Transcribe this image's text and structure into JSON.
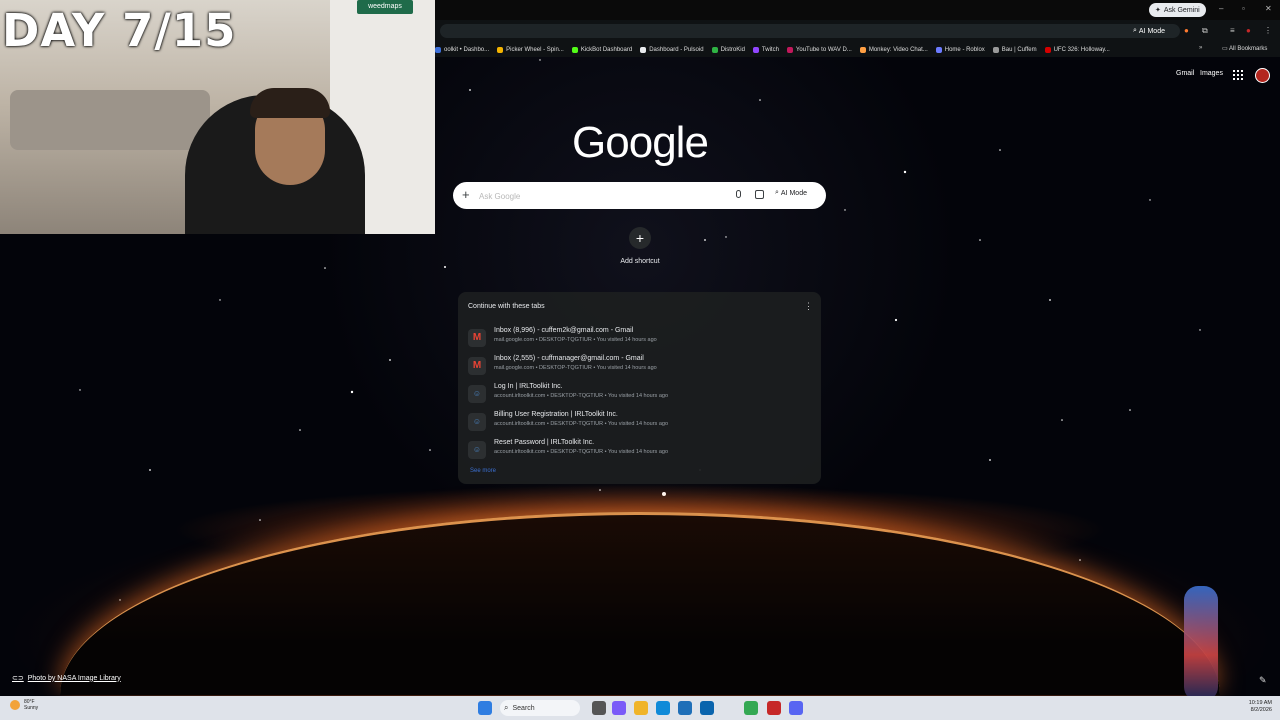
{
  "overlay": {
    "day_counter": "DAY 7/15",
    "sign_text": "weedmaps"
  },
  "browser": {
    "ask_gemini": "Ask Gemini",
    "ai_mode_chip": "AI Mode",
    "window_controls": [
      "–",
      "▫",
      "✕"
    ],
    "bookmarks": [
      {
        "label": "oolkit • Dashbo...",
        "color": "#3d6fd8"
      },
      {
        "label": "Picker Wheel - Spin...",
        "color": "#f4b400"
      },
      {
        "label": "KickBot Dashboard",
        "color": "#53fc18"
      },
      {
        "label": "Dashboard - Pulsoid",
        "color": "#e8eaed"
      },
      {
        "label": "DistroKid",
        "color": "#2fb344"
      },
      {
        "label": "Twitch",
        "color": "#9146ff"
      },
      {
        "label": "YouTube to WAV D...",
        "color": "#c2185b"
      },
      {
        "label": "Monkey: Video Chat...",
        "color": "#ff9f43"
      },
      {
        "label": "Home - Roblox",
        "color": "#6c7bff"
      },
      {
        "label": "Bau | Cuffem",
        "color": "#999999"
      },
      {
        "label": "UFC 326: Holloway...",
        "color": "#d50000"
      }
    ],
    "all_bookmarks": "All Bookmarks"
  },
  "google": {
    "gmail_link": "Gmail",
    "images_link": "Images",
    "logo": "Google",
    "search_placeholder": "Ask Google",
    "ai_mode_button": "AI Mode",
    "add_shortcut": "Add shortcut"
  },
  "continue_card": {
    "title": "Continue with these tabs",
    "items": [
      {
        "icon": "M",
        "type": "gmail",
        "title": "Inbox (8,996) - cuffem2k@gmail.com - Gmail",
        "meta": "mail.google.com • DESKTOP-TQGTIUR • You visited 14 hours ago"
      },
      {
        "icon": "M",
        "type": "gmail",
        "title": "Inbox (2,555) - cuffmanager@gmail.com - Gmail",
        "meta": "mail.google.com • DESKTOP-TQGTIUR • You visited 14 hours ago"
      },
      {
        "icon": "☺",
        "type": "irl",
        "title": "Log In | IRLToolkit Inc.",
        "meta": "account.irltoolkit.com • DESKTOP-TQGTIUR • You visited 14 hours ago"
      },
      {
        "icon": "☺",
        "type": "irl",
        "title": "Billing User Registration | IRLToolkit Inc.",
        "meta": "account.irltoolkit.com • DESKTOP-TQGTIUR • You visited 14 hours ago"
      },
      {
        "icon": "☺",
        "type": "irl",
        "title": "Reset Password | IRLToolkit Inc.",
        "meta": "account.irltoolkit.com • DESKTOP-TQGTIUR • You visited 14 hours ago"
      }
    ],
    "see_more": "See more"
  },
  "background": {
    "photo_credit": "Photo by NASA Image Library"
  },
  "taskbar": {
    "weather_temp": "80°F",
    "weather_desc": "Sunny",
    "search_label": "Search",
    "time": "10:19 AM",
    "date": "8/2/2026",
    "apps": [
      {
        "name": "start",
        "color": "#2f7de1"
      },
      {
        "name": "task-view",
        "color": "#555555"
      },
      {
        "name": "copilot",
        "color": "#7a5af8"
      },
      {
        "name": "file-explorer",
        "color": "#f0b429"
      },
      {
        "name": "edge",
        "color": "#0f8ad8"
      },
      {
        "name": "store",
        "color": "#1f6fb8"
      },
      {
        "name": "outlook",
        "color": "#0a64ad"
      },
      {
        "name": "chrome",
        "color": "#34a853"
      },
      {
        "name": "app-red",
        "color": "#c62828"
      },
      {
        "name": "discord",
        "color": "#5865f2"
      }
    ]
  }
}
